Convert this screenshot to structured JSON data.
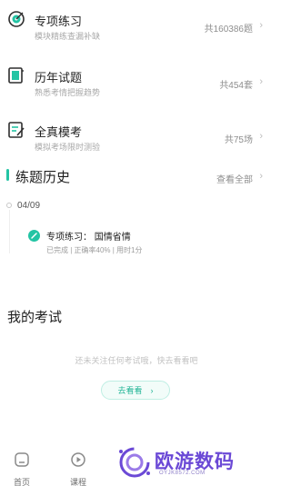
{
  "practice_items": [
    {
      "icon": "target-icon",
      "title": "专项练习",
      "subtitle": "模块精练查漏补缺",
      "count": "共160386题"
    },
    {
      "icon": "book-icon",
      "title": "历年试题",
      "subtitle": "熟悉考情把握趋势",
      "count": "共454套"
    },
    {
      "icon": "edit-paper-icon",
      "title": "全真模考",
      "subtitle": "模拟考场限时测验",
      "count": "共75场"
    }
  ],
  "history": {
    "title": "练题历史",
    "view_all": "查看全部",
    "date": "04/09",
    "record": {
      "title": "专项练习： 国情省情",
      "meta": "已完成 | 正确率40% | 用时1分"
    }
  },
  "my_exam": {
    "title": "我的考试",
    "empty_text": "还未关注任何考试哦，快去看看吧",
    "go_label": "去看看"
  },
  "tabbar": {
    "tabs": [
      {
        "label": "首页",
        "icon": "home-icon"
      },
      {
        "label": "课程",
        "icon": "play-icon"
      }
    ]
  },
  "watermark": {
    "text": "欧游数码",
    "url": "OYJK8572.COM"
  },
  "colors": {
    "accent": "#23c4a4",
    "watermark": "#6b49d6"
  }
}
